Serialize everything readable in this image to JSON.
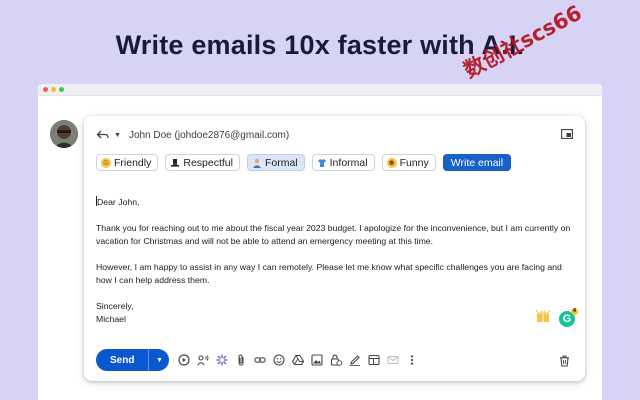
{
  "headline": "Write emails 10x faster with A.I.",
  "watermark": "数创社scs66",
  "compose": {
    "recipient": "John Doe (johdoe2876@gmail.com)",
    "tones": [
      {
        "label": "Friendly",
        "icon": "smile-icon",
        "selected": false
      },
      {
        "label": "Respectful",
        "icon": "top-hat-icon",
        "selected": false
      },
      {
        "label": "Formal",
        "icon": "office-worker-icon",
        "selected": true
      },
      {
        "label": "Informal",
        "icon": "t-shirt-icon",
        "selected": false
      },
      {
        "label": "Funny",
        "icon": "grin-icon",
        "selected": false
      }
    ],
    "write_button": "Write email",
    "body": {
      "greeting": "Dear John,",
      "paragraph1": "Thank you for reaching out to me about the fiscal year 2023 budget. I apologize for the inconvenience, but I am currently on vacation for Christmas and will not be able to attend an emergency meeting at this time.",
      "paragraph2": "However, I am happy to assist in any way I can remotely. Please let me know what specific challenges you are facing and how I can help address them.",
      "closing": "Sincerely,",
      "signature": "Michael"
    },
    "grammarly_badge": "4",
    "send_label": "Send"
  },
  "colors": {
    "background": "#d6d3f4",
    "send_button": "#0b57d0",
    "write_button": "#1761c8",
    "watermark": "#b3121f"
  }
}
